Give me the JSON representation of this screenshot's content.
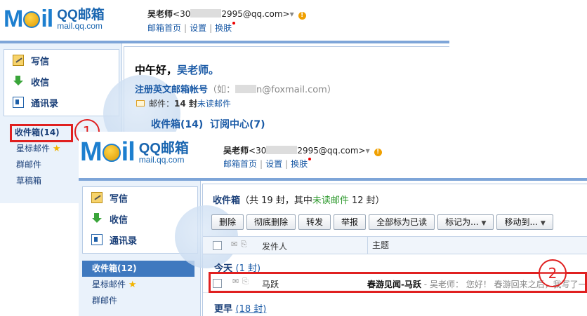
{
  "top": {
    "logo_text": "M◯il",
    "logo_brand": "QQ邮箱",
    "logo_domain": "mail.qq.com",
    "user_name": "吴老师",
    "user_email": "<30",
    "user_email_tail": "2995@qq.com>",
    "dropdown": "▾",
    "warn": "!",
    "link_home": "邮箱首页",
    "link_settings": "设置",
    "link_skin": "换肤",
    "sep": "|"
  },
  "nav": {
    "compose": "写信",
    "inbox": "收信",
    "contacts": "通讯录"
  },
  "folders_back": {
    "inbox": "收件箱(14)",
    "starred": "星标邮件",
    "groups": "群邮件",
    "drafts": "草稿箱"
  },
  "folders_front": {
    "inbox": "收件箱(12)",
    "starred": "星标邮件",
    "groups": "群邮件"
  },
  "home": {
    "greeting_pre": "中午好，",
    "greeting_name": "吴老师。",
    "register_main": "注册英文邮箱帐号",
    "register_hint_pre": "（如：",
    "register_hint_post": "n@foxmail.com）",
    "mail_label": "邮件：",
    "mail_count": "14 封",
    "mail_unread": "未读邮件",
    "link_inbox": "收件箱(14)",
    "link_rss": "订阅中心(7)"
  },
  "list": {
    "title": "收件箱",
    "summary_pre": "（共 19 封，其中",
    "summary_unread": "未读邮件",
    "summary_post": "12 封）",
    "buttons": [
      "删除",
      "彻底删除",
      "转发",
      "举报",
      "全部标为已读",
      "标记为...",
      "移动到..."
    ],
    "col_sender": "发件人",
    "col_subject": "主题",
    "group_today": "今天",
    "group_today_count": "(1 封)",
    "group_earlier": "更早",
    "group_earlier_count": "(18 封)",
    "row_sender": "马跃",
    "row_subject": "春游见闻-马跃",
    "row_preview": " - 吴老师： 您好！ 春游回来之后，我写了一"
  },
  "annotations": {
    "step1": "1",
    "step2": "2"
  },
  "colors": {
    "brand_blue": "#1d7fcf",
    "link_blue": "#1a5aa6",
    "highlight_red": "#e02020",
    "unread_green": "#2f9a2f"
  }
}
